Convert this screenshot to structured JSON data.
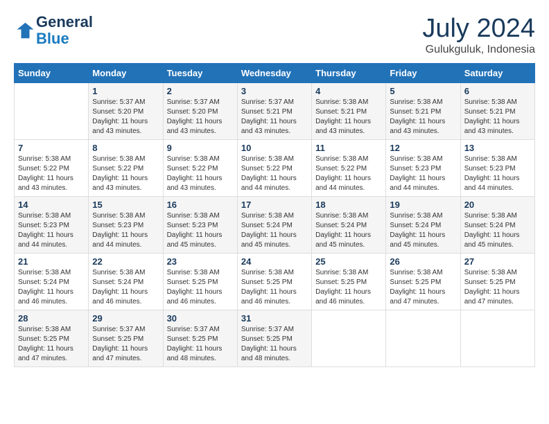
{
  "logo": {
    "line1": "General",
    "line2": "Blue"
  },
  "title": "July 2024",
  "subtitle": "Gulukguluk, Indonesia",
  "days_header": [
    "Sunday",
    "Monday",
    "Tuesday",
    "Wednesday",
    "Thursday",
    "Friday",
    "Saturday"
  ],
  "weeks": [
    [
      {
        "num": "",
        "sunrise": "",
        "sunset": "",
        "daylight": ""
      },
      {
        "num": "1",
        "sunrise": "5:37 AM",
        "sunset": "5:20 PM",
        "daylight": "11 hours and 43 minutes."
      },
      {
        "num": "2",
        "sunrise": "5:37 AM",
        "sunset": "5:20 PM",
        "daylight": "11 hours and 43 minutes."
      },
      {
        "num": "3",
        "sunrise": "5:37 AM",
        "sunset": "5:21 PM",
        "daylight": "11 hours and 43 minutes."
      },
      {
        "num": "4",
        "sunrise": "5:38 AM",
        "sunset": "5:21 PM",
        "daylight": "11 hours and 43 minutes."
      },
      {
        "num": "5",
        "sunrise": "5:38 AM",
        "sunset": "5:21 PM",
        "daylight": "11 hours and 43 minutes."
      },
      {
        "num": "6",
        "sunrise": "5:38 AM",
        "sunset": "5:21 PM",
        "daylight": "11 hours and 43 minutes."
      }
    ],
    [
      {
        "num": "7",
        "sunrise": "5:38 AM",
        "sunset": "5:22 PM",
        "daylight": "11 hours and 43 minutes."
      },
      {
        "num": "8",
        "sunrise": "5:38 AM",
        "sunset": "5:22 PM",
        "daylight": "11 hours and 43 minutes."
      },
      {
        "num": "9",
        "sunrise": "5:38 AM",
        "sunset": "5:22 PM",
        "daylight": "11 hours and 43 minutes."
      },
      {
        "num": "10",
        "sunrise": "5:38 AM",
        "sunset": "5:22 PM",
        "daylight": "11 hours and 44 minutes."
      },
      {
        "num": "11",
        "sunrise": "5:38 AM",
        "sunset": "5:22 PM",
        "daylight": "11 hours and 44 minutes."
      },
      {
        "num": "12",
        "sunrise": "5:38 AM",
        "sunset": "5:23 PM",
        "daylight": "11 hours and 44 minutes."
      },
      {
        "num": "13",
        "sunrise": "5:38 AM",
        "sunset": "5:23 PM",
        "daylight": "11 hours and 44 minutes."
      }
    ],
    [
      {
        "num": "14",
        "sunrise": "5:38 AM",
        "sunset": "5:23 PM",
        "daylight": "11 hours and 44 minutes."
      },
      {
        "num": "15",
        "sunrise": "5:38 AM",
        "sunset": "5:23 PM",
        "daylight": "11 hours and 44 minutes."
      },
      {
        "num": "16",
        "sunrise": "5:38 AM",
        "sunset": "5:23 PM",
        "daylight": "11 hours and 45 minutes."
      },
      {
        "num": "17",
        "sunrise": "5:38 AM",
        "sunset": "5:24 PM",
        "daylight": "11 hours and 45 minutes."
      },
      {
        "num": "18",
        "sunrise": "5:38 AM",
        "sunset": "5:24 PM",
        "daylight": "11 hours and 45 minutes."
      },
      {
        "num": "19",
        "sunrise": "5:38 AM",
        "sunset": "5:24 PM",
        "daylight": "11 hours and 45 minutes."
      },
      {
        "num": "20",
        "sunrise": "5:38 AM",
        "sunset": "5:24 PM",
        "daylight": "11 hours and 45 minutes."
      }
    ],
    [
      {
        "num": "21",
        "sunrise": "5:38 AM",
        "sunset": "5:24 PM",
        "daylight": "11 hours and 46 minutes."
      },
      {
        "num": "22",
        "sunrise": "5:38 AM",
        "sunset": "5:24 PM",
        "daylight": "11 hours and 46 minutes."
      },
      {
        "num": "23",
        "sunrise": "5:38 AM",
        "sunset": "5:25 PM",
        "daylight": "11 hours and 46 minutes."
      },
      {
        "num": "24",
        "sunrise": "5:38 AM",
        "sunset": "5:25 PM",
        "daylight": "11 hours and 46 minutes."
      },
      {
        "num": "25",
        "sunrise": "5:38 AM",
        "sunset": "5:25 PM",
        "daylight": "11 hours and 46 minutes."
      },
      {
        "num": "26",
        "sunrise": "5:38 AM",
        "sunset": "5:25 PM",
        "daylight": "11 hours and 47 minutes."
      },
      {
        "num": "27",
        "sunrise": "5:38 AM",
        "sunset": "5:25 PM",
        "daylight": "11 hours and 47 minutes."
      }
    ],
    [
      {
        "num": "28",
        "sunrise": "5:38 AM",
        "sunset": "5:25 PM",
        "daylight": "11 hours and 47 minutes."
      },
      {
        "num": "29",
        "sunrise": "5:37 AM",
        "sunset": "5:25 PM",
        "daylight": "11 hours and 47 minutes."
      },
      {
        "num": "30",
        "sunrise": "5:37 AM",
        "sunset": "5:25 PM",
        "daylight": "11 hours and 48 minutes."
      },
      {
        "num": "31",
        "sunrise": "5:37 AM",
        "sunset": "5:25 PM",
        "daylight": "11 hours and 48 minutes."
      },
      {
        "num": "",
        "sunrise": "",
        "sunset": "",
        "daylight": ""
      },
      {
        "num": "",
        "sunrise": "",
        "sunset": "",
        "daylight": ""
      },
      {
        "num": "",
        "sunrise": "",
        "sunset": "",
        "daylight": ""
      }
    ]
  ]
}
